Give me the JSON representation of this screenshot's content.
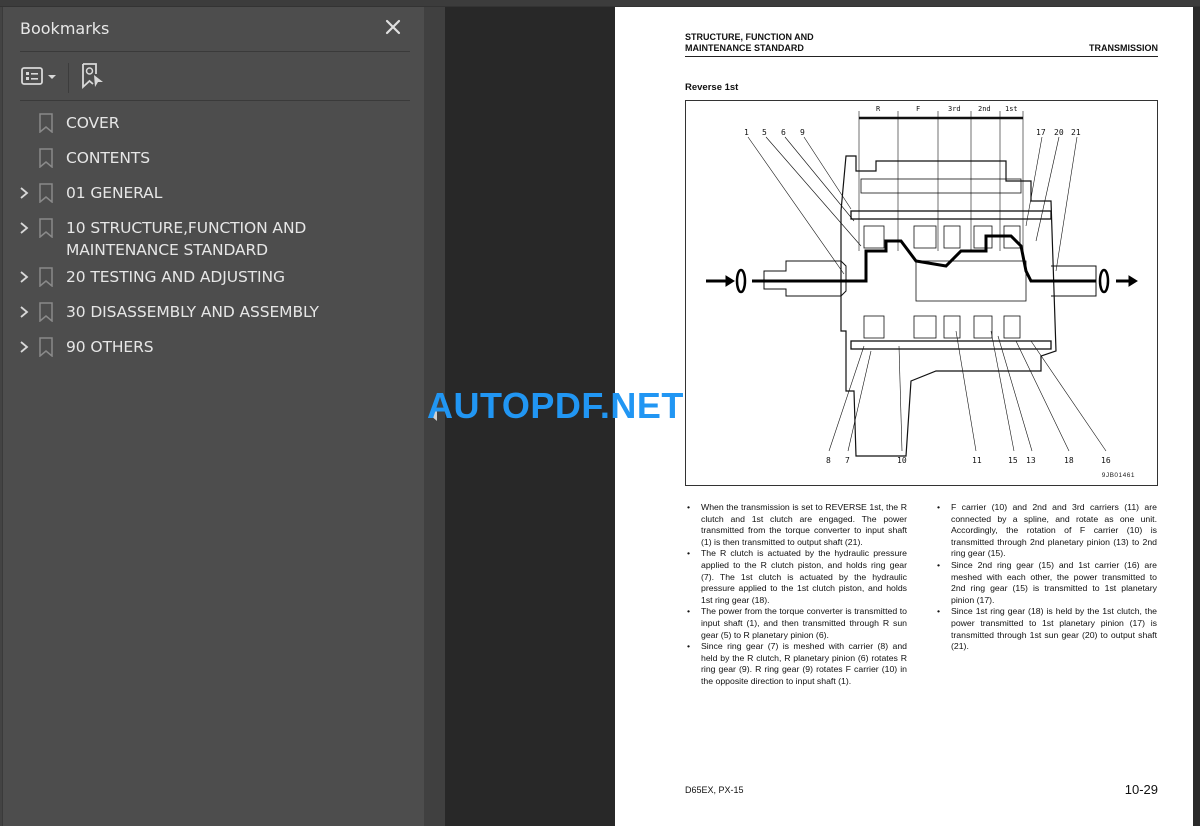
{
  "bookmarks_panel": {
    "title": "Bookmarks",
    "close_icon": "close-icon",
    "toolbar": {
      "options_icon": "list-options-icon",
      "options_dropdown_icon": "caret-down-icon",
      "find_bookmark_icon": "bookmark-search-icon"
    },
    "items": [
      {
        "label": "COVER",
        "expandable": false,
        "icon": "bookmark-icon"
      },
      {
        "label": "CONTENTS",
        "expandable": false,
        "icon": "bookmark-icon"
      },
      {
        "label": "01 GENERAL",
        "expandable": true,
        "icon": "bookmark-icon"
      },
      {
        "label": "10 STRUCTURE,FUNCTION AND MAINTENANCE STANDARD",
        "expandable": true,
        "icon": "bookmark-icon"
      },
      {
        "label": "20 TESTING AND ADJUSTING",
        "expandable": true,
        "icon": "bookmark-icon"
      },
      {
        "label": "30 DISASSEMBLY AND ASSEMBLY",
        "expandable": true,
        "icon": "bookmark-icon"
      },
      {
        "label": "90 OTHERS",
        "expandable": true,
        "icon": "bookmark-icon"
      }
    ]
  },
  "watermark": {
    "text": "AUTOPDF.NET",
    "color": "#2196f3"
  },
  "document": {
    "header_left_line1": "STRUCTURE, FUNCTION AND",
    "header_left_line2": "MAINTENANCE STANDARD",
    "header_right": "TRANSMISSION",
    "section_title": "Reverse 1st",
    "figure": {
      "id": "9JB01461",
      "range_labels": [
        "R",
        "F",
        "3rd",
        "2nd",
        "1st"
      ],
      "callouts_top": [
        "1",
        "5",
        "6",
        "9",
        "17",
        "20",
        "21"
      ],
      "callouts_bottom": [
        "8",
        "7",
        "10",
        "11",
        "15",
        "13",
        "18",
        "16"
      ]
    },
    "left_column": [
      "When the transmission is set to REVERSE 1st, the R clutch and 1st clutch are engaged. The power transmitted from the torque converter to input shaft (1) is then transmitted to output shaft (21).",
      "The R clutch is actuated by the hydraulic pressure applied to the R clutch piston, and holds ring gear (7). The 1st clutch is actuated by the hydraulic pressure applied to the 1st clutch piston, and holds 1st ring gear (18).",
      "The power from the torque converter is transmitted to input shaft (1), and then transmitted through R sun gear (5) to R planetary pinion (6).",
      "Since ring gear (7) is meshed with carrier (8) and held by the R clutch, R planetary pinion (6) rotates R ring gear (9). R ring gear (9) rotates F carrier (10) in the opposite direction to input shaft (1)."
    ],
    "right_column": [
      "F carrier (10) and 2nd and 3rd carriers (11) are connected by a spline, and rotate as one unit. Accordingly, the rotation of F carrier (10) is transmitted through 2nd planetary pinion (13) to 2nd ring gear (15).",
      "Since 2nd ring gear (15) and 1st carrier (16) are meshed with each other, the power transmitted to 2nd ring gear (15) is transmitted to 1st planetary pinion (17).",
      "Since 1st ring gear (18) is held by the 1st clutch, the power transmitted to 1st planetary pinion (17) is transmitted through 1st sun gear (20) to output shaft (21)."
    ],
    "footer_left": "D65EX, PX-15",
    "footer_right": "10-29"
  }
}
